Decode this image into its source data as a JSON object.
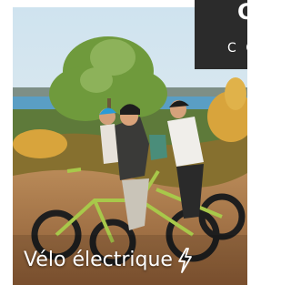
{
  "promo": {
    "title": "C",
    "subtitle": "C C"
  },
  "card": {
    "caption": "Vélo électrique",
    "caption_icon": "lightning-bolt-icon",
    "image_alt": "Three riders on electric fat-tire bikes on a sandy ridge above a lake"
  },
  "colors": {
    "promo_background": "#2b2b2b",
    "caption_text": "#ffffff",
    "page_background": "#ffffff"
  }
}
